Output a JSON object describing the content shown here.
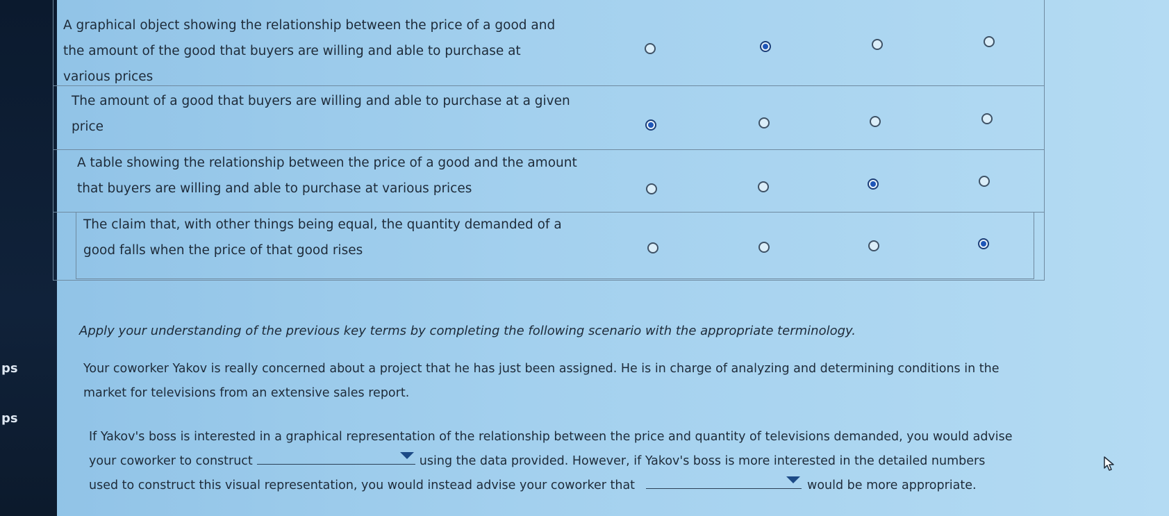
{
  "sidebar": {
    "labels": [
      "ps",
      "ps"
    ]
  },
  "table": {
    "rows": [
      {
        "lines": [
          "A graphical object showing the relationship between the price of a good and",
          "the amount of the good that buyers are willing and able to purchase at",
          "various prices"
        ],
        "selected_column": 2
      },
      {
        "lines": [
          "The amount of a good that buyers are willing and able to purchase at a given",
          "price"
        ],
        "selected_column": 1
      },
      {
        "lines": [
          "A table showing the relationship between the price of a good and the amount",
          "that buyers are willing and able to purchase at various prices"
        ],
        "selected_column": 3
      },
      {
        "lines": [
          "The claim that, with other things being equal, the quantity demanded of a",
          "good falls when the price of that good rises"
        ],
        "selected_column": 4
      }
    ]
  },
  "instructions": "Apply your understanding of the previous key terms by completing the following scenario with the appropriate terminology.",
  "scenario": {
    "line1": "Your coworker Yakov is really concerned about a project that he has just been assigned. He is in charge of analyzing and determining conditions in the",
    "line2": "market for televisions from an extensive sales report."
  },
  "question": {
    "line1": "If Yakov's boss is interested in a graphical representation of the relationship between the price and quantity of televisions demanded, you would advise",
    "line2_before": "your coworker to construct",
    "line2_after": "using the data provided. However, if Yakov's boss is more interested in the detailed numbers",
    "line3_before": "used to construct this visual representation, you would instead advise your coworker that",
    "line3_after": "would be more appropriate.",
    "dropdown1_value": "",
    "dropdown2_value": ""
  },
  "colors": {
    "background": "#a3d0ee",
    "radio_selected": "#1f56b8",
    "sidebar": "#0b1a2e"
  },
  "icons": [
    "radio-button-icon",
    "dropdown-arrow-icon",
    "mouse-cursor-icon"
  ]
}
